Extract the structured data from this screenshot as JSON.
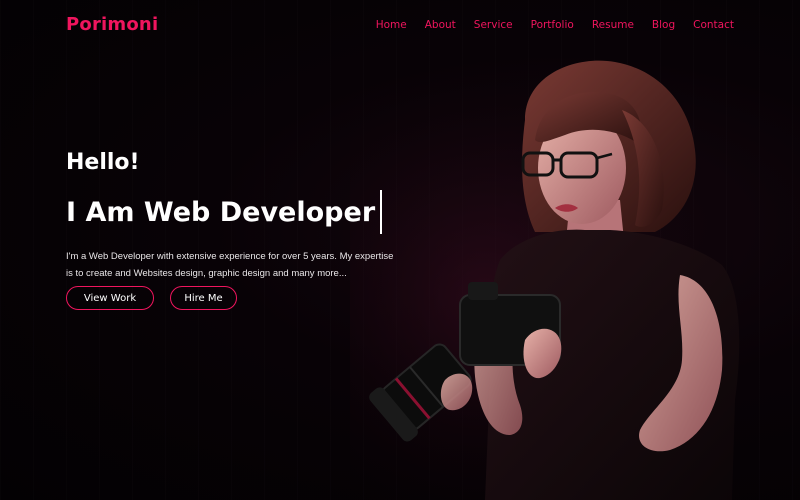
{
  "header": {
    "logo": "Porimoni",
    "nav": [
      "Home",
      "About",
      "Service",
      "Portfolio",
      "Resume",
      "Blog",
      "Contact"
    ]
  },
  "hero": {
    "greeting": "Hello!",
    "headline": "I Am Web Developer",
    "intro": "I'm a Web Developer with extensive experience for over 5 years. My expertise is to create and Websites design, graphic design and many more...",
    "buttons": {
      "view_work": "View Work",
      "hire_me": "Hire Me"
    }
  },
  "colors": {
    "accent": "#f0155e",
    "background": "#040104",
    "text": "#ffffff"
  }
}
